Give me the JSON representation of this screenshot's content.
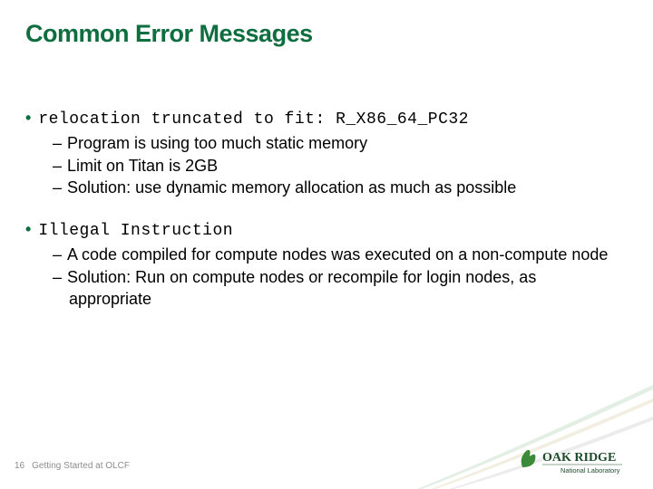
{
  "title": "Common Error Messages",
  "bullets": [
    {
      "mono": "relocation truncated to fit: R_X86_64_PC32",
      "subs": [
        "Program is using too much static memory",
        "Limit on Titan is 2GB",
        "Solution: use dynamic memory allocation as much as possible"
      ]
    },
    {
      "mono": "Illegal Instruction",
      "subs": [
        "A code compiled for compute nodes was executed on a non-compute node",
        "Solution: Run on compute nodes or recompile for login nodes, as appropriate"
      ]
    }
  ],
  "footer": {
    "page": "16",
    "text": "Getting Started at OLCF"
  },
  "logo": {
    "top": "OAK RIDGE",
    "sub": "National Laboratory",
    "leaf_color": "#3a8a3a",
    "text_color": "#1d4c2a"
  }
}
